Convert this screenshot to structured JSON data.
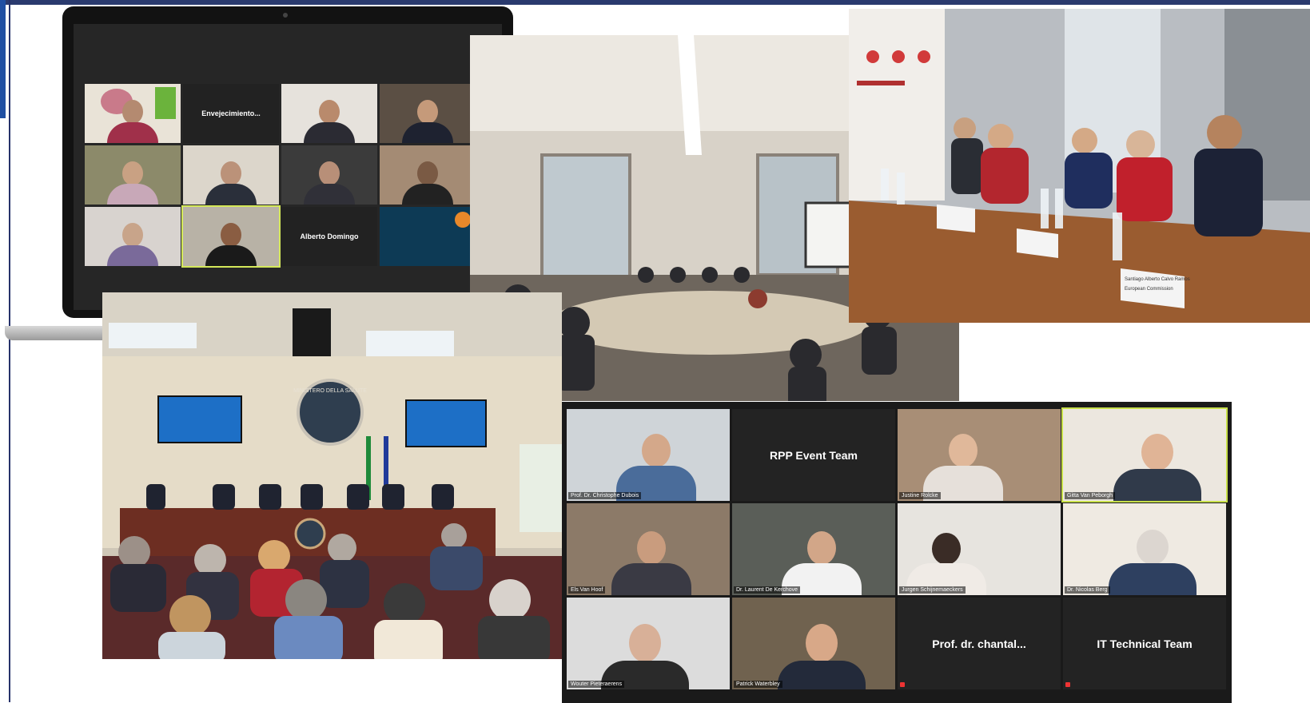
{
  "laptop_call": {
    "tiles": [
      {
        "label": ""
      },
      {
        "label": "Envejecimiento..."
      },
      {
        "label": ""
      },
      {
        "label": ""
      },
      {
        "label": ""
      },
      {
        "label": ""
      },
      {
        "label": ""
      },
      {
        "label": ""
      },
      {
        "label": ""
      },
      {
        "label": ""
      },
      {
        "label": "Alberto Domingo"
      },
      {
        "label": ""
      }
    ]
  },
  "meeting_room": {
    "place_cards": [
      "Santiago Alberto Calvo Ramos",
      "European Commission"
    ]
  },
  "ministry_hall": {
    "seal_text": "MINISTERO DELLA SALUTE"
  },
  "zoom_call": {
    "tiles": [
      {
        "type": "video",
        "name": "Prof. Dr. Christophe Dubois"
      },
      {
        "type": "text",
        "label": "RPP Event Team"
      },
      {
        "type": "video",
        "name": "Justine Rolcke"
      },
      {
        "type": "video",
        "name": "Gitta Van Peborgh"
      },
      {
        "type": "video",
        "name": "Els Van Hoof"
      },
      {
        "type": "video",
        "name": "Dr. Laurent De Kerchove"
      },
      {
        "type": "video",
        "name": "Jurgen Schijnemaeckers"
      },
      {
        "type": "video",
        "name": "Dr. Nicolas Berg"
      },
      {
        "type": "video",
        "name": "Wouter Pieteraerens"
      },
      {
        "type": "video",
        "name": "Patrick Waterbley"
      },
      {
        "type": "text",
        "label": "Prof. dr. chantal..."
      },
      {
        "type": "text",
        "label": "IT Technical Team"
      }
    ]
  }
}
